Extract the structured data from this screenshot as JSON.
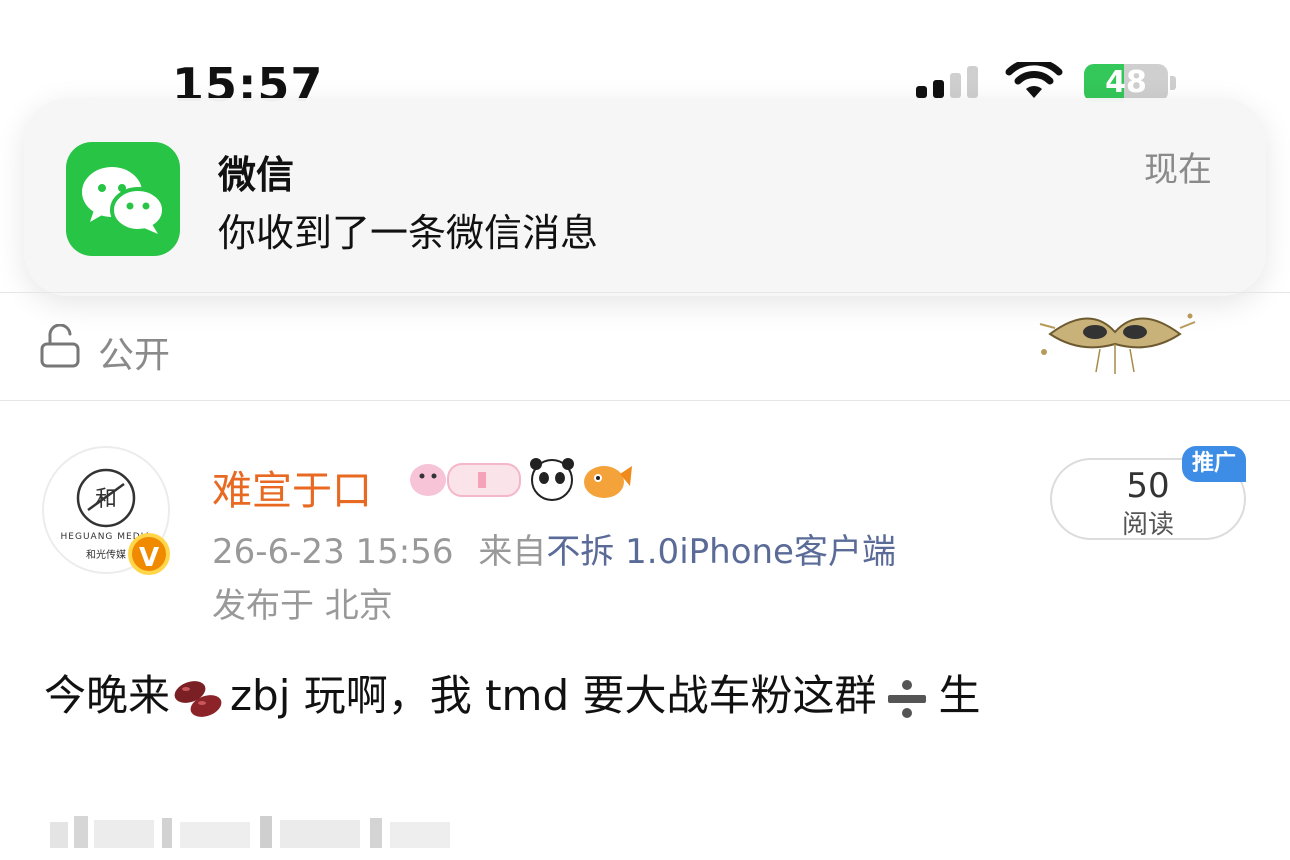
{
  "status_bar": {
    "time": "15:57",
    "battery_level": "48",
    "battery_fraction": 0.48
  },
  "notification": {
    "app_name": "微信",
    "message": "你收到了一条微信消息",
    "time": "现在",
    "icon": "wechat-icon",
    "accent_color": "#28c445"
  },
  "visibility": {
    "label": "公开",
    "icon": "unlock-icon"
  },
  "post": {
    "username": "难宣于口",
    "username_color": "#e86a22",
    "avatar_brand": "HEGUANG MEDIA",
    "avatar_brand_cn": "和光传媒",
    "verified_badge": "V",
    "date": "26-6-23 15:56",
    "from_prefix": "来自",
    "source": "不拆 1.0iPhone客户端",
    "location": "发布于 北京",
    "reads": {
      "count": "50",
      "label": "阅读"
    },
    "promo_tag": "推广",
    "body": {
      "part1": "今晚来",
      "part2": "zbj 玩啊，我 tmd 要大战车粉这群",
      "part3": "生"
    }
  },
  "colors": {
    "link": "#5a6b98",
    "meta_gray": "#999999",
    "promo_blue": "#3d8de6"
  }
}
